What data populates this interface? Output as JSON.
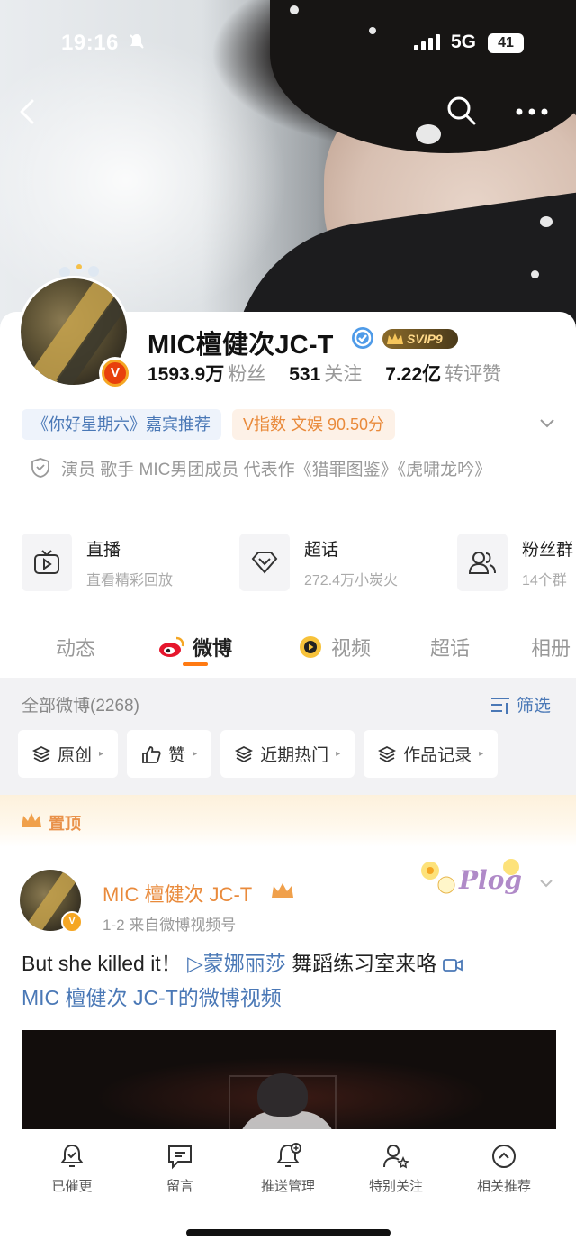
{
  "status_bar": {
    "time": "19:16",
    "network": "5G",
    "battery": "41"
  },
  "profile": {
    "name": "MIC檀健次JC-T",
    "svip_badge": "SVIP9",
    "stats": [
      {
        "value": "1593.9万",
        "label": "粉丝"
      },
      {
        "value": "531",
        "label": "关注"
      },
      {
        "value": "7.22亿",
        "label": "转评赞"
      }
    ],
    "tags": [
      {
        "text": "《你好星期六》嘉宾推荐"
      },
      {
        "text": "V指数 文娱 90.50分"
      }
    ],
    "bio": "演员 歌手 MIC男团成员 代表作《猎罪图鉴》《虎啸龙吟》"
  },
  "quick_links": [
    {
      "title": "直播",
      "subtitle": "直看精彩回放",
      "icon": "tv-icon"
    },
    {
      "title": "超话",
      "subtitle": "272.4万小炭火",
      "icon": "diamond-icon"
    },
    {
      "title": "粉丝群",
      "subtitle": "14个群",
      "icon": "group-icon"
    }
  ],
  "tabs": {
    "dynamic": "动态",
    "weibo": "微博",
    "video": "视频",
    "supertopic": "超话",
    "album": "相册"
  },
  "feed": {
    "title": "全部微博(2268)",
    "filter": "筛选",
    "chips": [
      "原创",
      "赞",
      "近期热门",
      "作品记录"
    ],
    "pinned": "置顶"
  },
  "post": {
    "author": "MIC 檀健次 JC-T",
    "meta": "1-2  来自微博视频号",
    "text_lead": "But she killed it！",
    "text_link": "▷蒙娜丽莎",
    "text_rest": " 舞蹈练习室来咯 ",
    "text_link2": "MIC 檀健次 JC-T的微博视频",
    "sticker": "Plog"
  },
  "bottom_bar": [
    "已催更",
    "留言",
    "推送管理",
    "特别关注",
    "相关推荐"
  ],
  "colors": {
    "accent": "#ff7a12",
    "link": "#4a78b6",
    "orange_text": "#e98a3b"
  }
}
